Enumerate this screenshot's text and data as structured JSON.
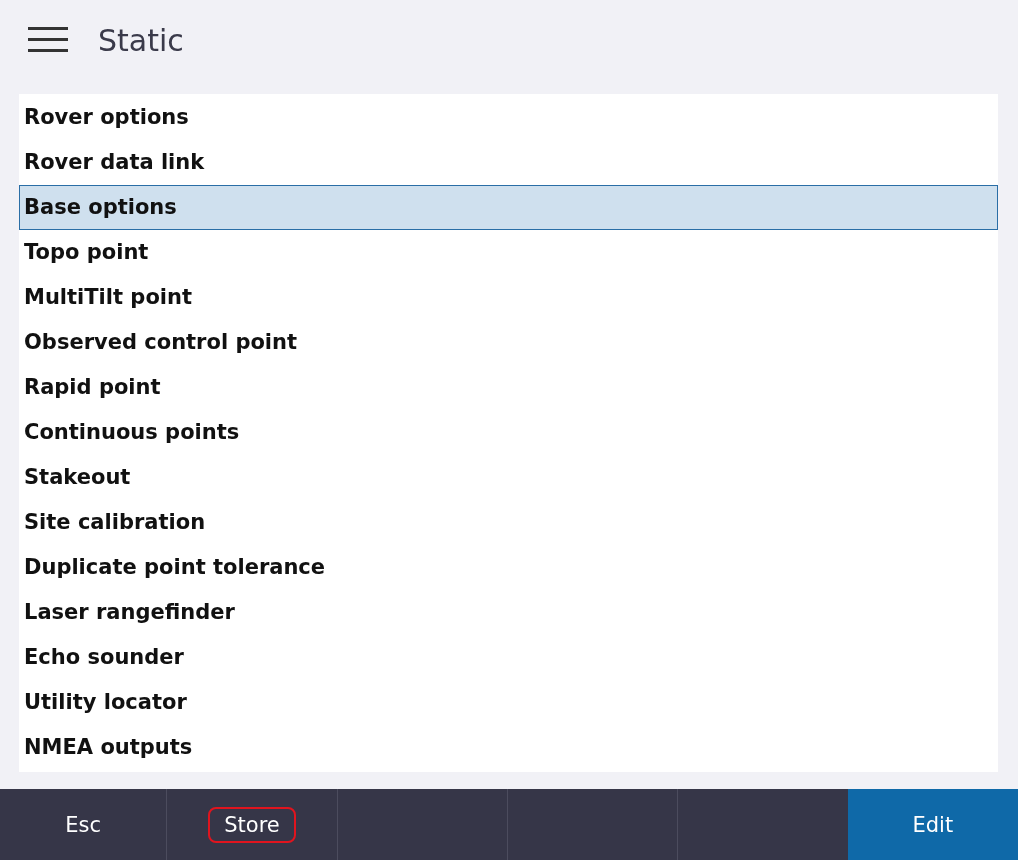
{
  "header": {
    "title": "Static"
  },
  "list": [
    {
      "label": "Rover options",
      "selected": false
    },
    {
      "label": "Rover data link",
      "selected": false
    },
    {
      "label": "Base options",
      "selected": true
    },
    {
      "label": "Topo point",
      "selected": false
    },
    {
      "label": "MultiTilt point",
      "selected": false
    },
    {
      "label": "Observed control point",
      "selected": false
    },
    {
      "label": "Rapid point",
      "selected": false
    },
    {
      "label": "Continuous points",
      "selected": false
    },
    {
      "label": "Stakeout",
      "selected": false
    },
    {
      "label": "Site calibration",
      "selected": false
    },
    {
      "label": "Duplicate point tolerance",
      "selected": false
    },
    {
      "label": "Laser rangefinder",
      "selected": false
    },
    {
      "label": "Echo sounder",
      "selected": false
    },
    {
      "label": "Utility locator",
      "selected": false
    },
    {
      "label": "NMEA outputs",
      "selected": false
    }
  ],
  "softkeys": [
    {
      "kind": "normal",
      "label": "Esc",
      "highlighted": false
    },
    {
      "kind": "normal",
      "label": "Store",
      "highlighted": true
    },
    {
      "kind": "empty"
    },
    {
      "kind": "empty"
    },
    {
      "kind": "empty"
    },
    {
      "kind": "primary",
      "label": "Edit",
      "highlighted": false
    }
  ]
}
